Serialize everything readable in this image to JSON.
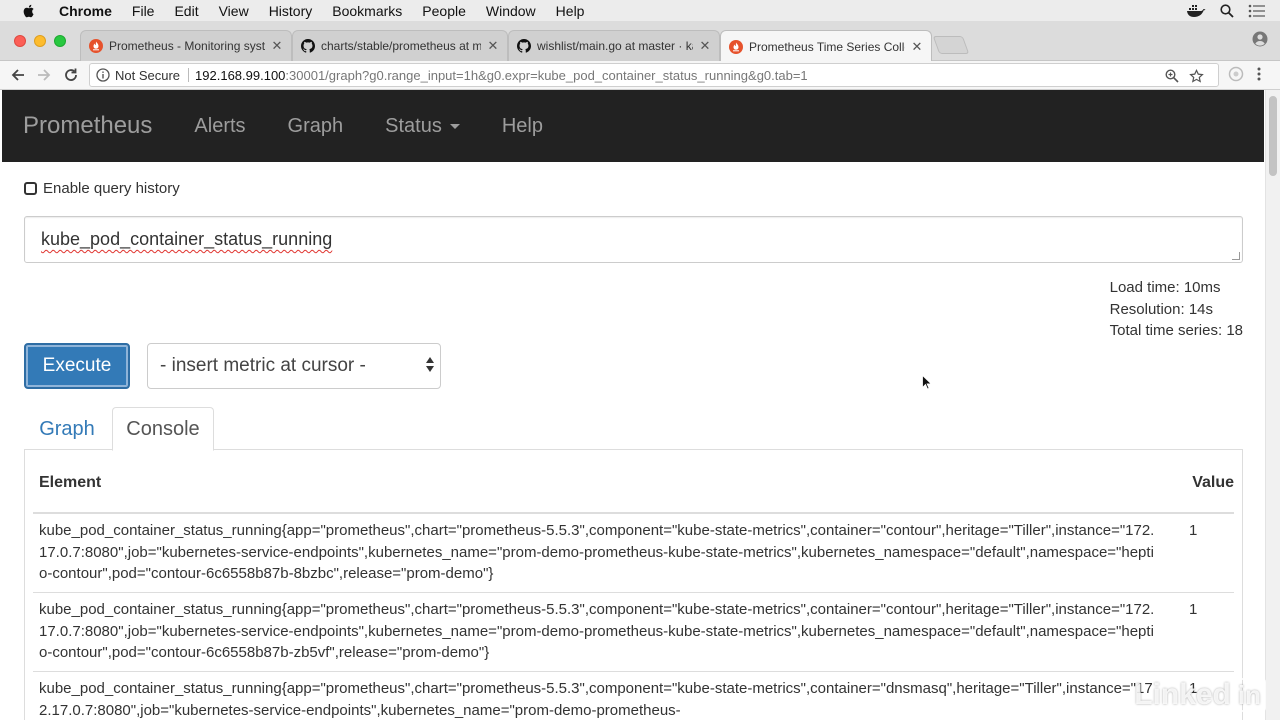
{
  "menubar": {
    "items": [
      "Chrome",
      "File",
      "Edit",
      "View",
      "History",
      "Bookmarks",
      "People",
      "Window",
      "Help"
    ]
  },
  "tabs": [
    {
      "title": "Prometheus - Monitoring syste",
      "icon": "prometheus-flame-icon"
    },
    {
      "title": "charts/stable/prometheus at m",
      "icon": "github-icon"
    },
    {
      "title": "wishlist/main.go at master · ka",
      "icon": "github-icon"
    },
    {
      "title": "Prometheus Time Series Collec",
      "icon": "prometheus-flame-icon"
    }
  ],
  "address": {
    "security": "Not Secure",
    "host": "192.168.99.100",
    "path": ":30001/graph?g0.range_input=1h&g0.expr=kube_pod_container_status_running&g0.tab=1"
  },
  "navbar": {
    "brand": "Prometheus",
    "links": [
      "Alerts",
      "Graph",
      "Status",
      "Help"
    ]
  },
  "query": {
    "history_label": "Enable query history",
    "expression": "kube_pod_container_status_running"
  },
  "stats": {
    "load_time": "Load time: 10ms",
    "resolution": "Resolution: 14s",
    "total_series": "Total time series: 18"
  },
  "controls": {
    "execute": "Execute",
    "insert_metric": "- insert metric at cursor -"
  },
  "panel_tabs": {
    "graph": "Graph",
    "console": "Console"
  },
  "table": {
    "headers": [
      "Element",
      "Value"
    ],
    "rows": [
      {
        "element": "kube_pod_container_status_running{app=\"prometheus\",chart=\"prometheus-5.5.3\",component=\"kube-state-metrics\",container=\"contour\",heritage=\"Tiller\",instance=\"172.17.0.7:8080\",job=\"kubernetes-service-endpoints\",kubernetes_name=\"prom-demo-prometheus-kube-state-metrics\",kubernetes_namespace=\"default\",namespace=\"heptio-contour\",pod=\"contour-6c6558b87b-8bzbc\",release=\"prom-demo\"}",
        "value": "1"
      },
      {
        "element": "kube_pod_container_status_running{app=\"prometheus\",chart=\"prometheus-5.5.3\",component=\"kube-state-metrics\",container=\"contour\",heritage=\"Tiller\",instance=\"172.17.0.7:8080\",job=\"kubernetes-service-endpoints\",kubernetes_name=\"prom-demo-prometheus-kube-state-metrics\",kubernetes_namespace=\"default\",namespace=\"heptio-contour\",pod=\"contour-6c6558b87b-zb5vf\",release=\"prom-demo\"}",
        "value": "1"
      },
      {
        "element": "kube_pod_container_status_running{app=\"prometheus\",chart=\"prometheus-5.5.3\",component=\"kube-state-metrics\",container=\"dnsmasq\",heritage=\"Tiller\",instance=\"172.17.0.7:8080\",job=\"kubernetes-service-endpoints\",kubernetes_name=\"prom-demo-prometheus-",
        "value": "1"
      }
    ]
  },
  "watermark": {
    "text": "Linked",
    "badge": "in"
  },
  "colors": {
    "navbar_bg": "#222222",
    "link_blue": "#337ab7",
    "execute_bg": "#337ab7"
  }
}
